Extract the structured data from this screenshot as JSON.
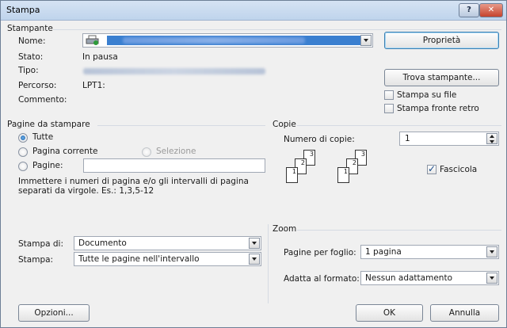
{
  "window": {
    "title": "Stampa",
    "help": "?",
    "close": "✕"
  },
  "printer": {
    "section": "Stampante",
    "name_label": "Nome:",
    "state_label": "Stato:",
    "state_value": "In pausa",
    "type_label": "Tipo:",
    "path_label": "Percorso:",
    "path_value": "LPT1:",
    "comment_label": "Commento:",
    "properties_button": "Proprietà",
    "find_button": "Trova stampante...",
    "print_to_file": "Stampa su file",
    "print_to_file_checked": false,
    "duplex": "Stampa fronte retro",
    "duplex_checked": false
  },
  "pages": {
    "section": "Pagine da stampare",
    "all": "Tutte",
    "current": "Pagina corrente",
    "selection": "Selezione",
    "pages": "Pagine:",
    "selected": "all",
    "pages_value": "",
    "hint_line1": "Immettere i numeri di pagina e/o gli intervalli di pagina",
    "hint_line2": "separati da virgole. Es.: 1,3,5-12"
  },
  "copies": {
    "section": "Copie",
    "count_label": "Numero di copie:",
    "count_value": "1",
    "collate": "Fascicola",
    "collate_checked": true,
    "page_numbers": [
      "1",
      "2",
      "3"
    ]
  },
  "what": {
    "print_what_label": "Stampa di:",
    "print_what_value": "Documento",
    "print_label": "Stampa:",
    "print_value": "Tutte le pagine nell'intervallo"
  },
  "zoom": {
    "section": "Zoom",
    "pages_per_sheet_label": "Pagine per foglio:",
    "pages_per_sheet_value": "1 pagina",
    "scale_label": "Adatta al formato:",
    "scale_value": "Nessun adattamento"
  },
  "footer": {
    "options": "Opzioni...",
    "ok": "OK",
    "cancel": "Annulla"
  }
}
